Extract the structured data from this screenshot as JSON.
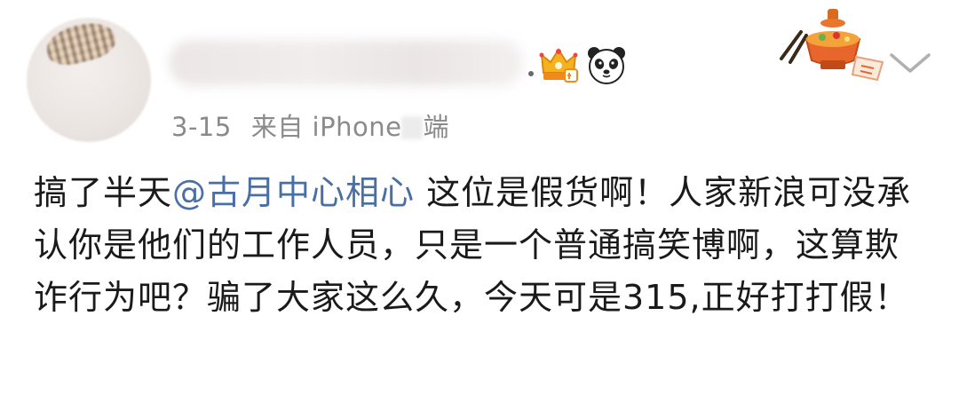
{
  "post": {
    "meta": {
      "date": "3-15",
      "source": "来自 iPhone",
      "source_tail": "端"
    },
    "badges": [
      {
        "icon": "crown-vip-icon",
        "color": "#f4a21a"
      },
      {
        "icon": "panda-icon",
        "color": "#222222"
      }
    ],
    "decoration": {
      "icon": "hotpot-sticker-icon",
      "color": "#e8662c"
    },
    "menu": {
      "icon": "chevron-down-icon",
      "color": "#b0b0b0"
    },
    "content": {
      "prefix": "搞了半天",
      "mention": "@古月中心相心",
      "suffix": " 这位是假货啊！人家新浪可没承认你是他们的工作人员，只是一个普通搞笑博啊，这算欺诈行为吧？骗了大家这么久，今天可是315,正好打打假！"
    },
    "colors": {
      "mention": "#4a6fa5",
      "text": "#1a1a1a",
      "meta": "#8a8a8a"
    }
  }
}
